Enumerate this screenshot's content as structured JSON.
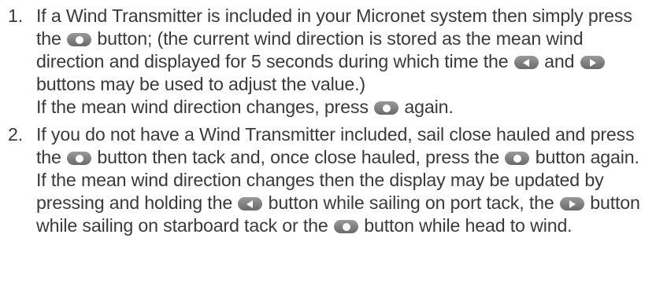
{
  "instructions": {
    "items": [
      {
        "number": "1.",
        "para1": {
          "t1": "If a Wind Transmitter is included in your Micronet system then simply press the",
          "t2": "button; (the current wind direction is stored as the mean wind direction and displayed for 5 seconds during which time the",
          "t3": "and",
          "t4": "buttons may be used to adjust the value.)"
        },
        "para2": {
          "t1": "If the mean wind direction changes, press",
          "t2": "again."
        }
      },
      {
        "number": "2.",
        "para1": {
          "t1": "If you do not have a Wind Transmitter included, sail close hauled and press the",
          "t2": "button then tack and, once close hauled, press the",
          "t3": "button again."
        },
        "para2": {
          "t1": "If the mean wind direction changes then the display may be updated by pressing and holding the",
          "t2": "button while sailing on port tack, the",
          "t3": "button while sailing on starboard tack or the",
          "t4": "button while head to wind."
        }
      }
    ]
  },
  "icons": {
    "center": "center-button-icon",
    "left": "left-arrow-button-icon",
    "right": "right-arrow-button-icon"
  },
  "colors": {
    "text": "#3a3a3a",
    "button": "#808080",
    "button_symbol": "#ffffff"
  }
}
